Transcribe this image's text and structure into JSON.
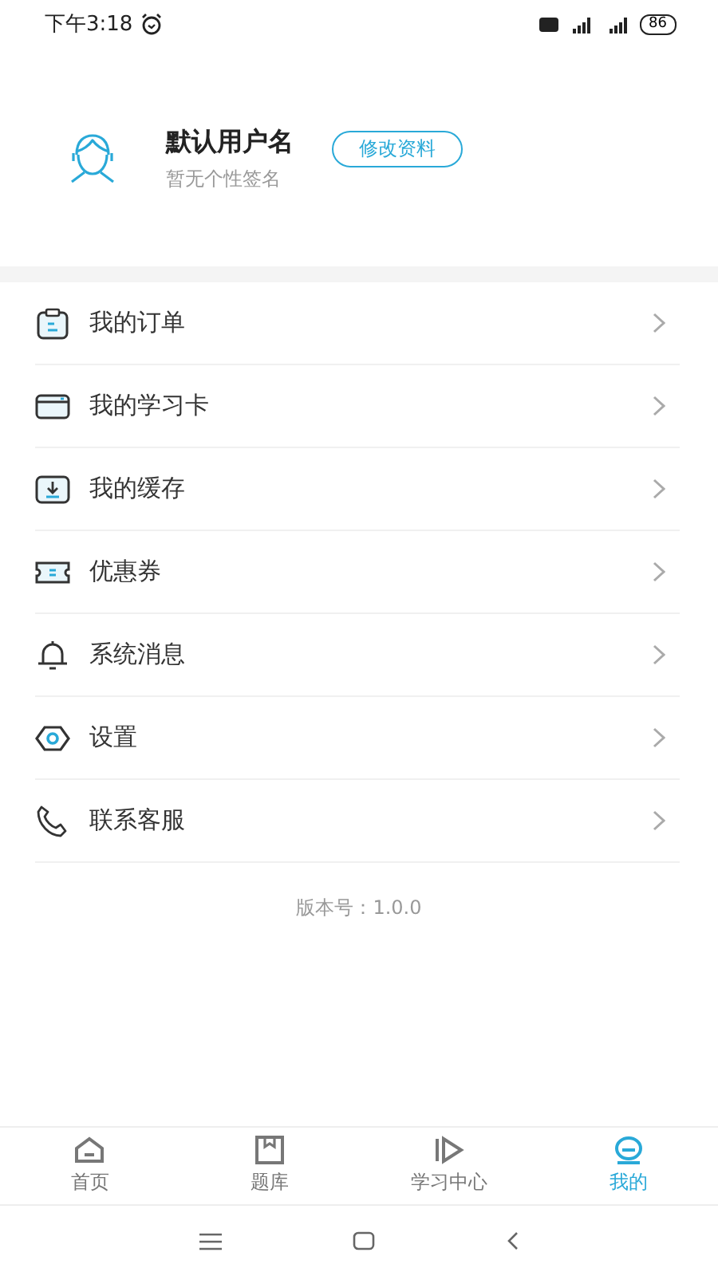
{
  "status_bar": {
    "time": "下午3:18",
    "battery": "86"
  },
  "profile": {
    "name": "默认用户名",
    "signature": "暂无个性签名",
    "edit_button": "修改资料"
  },
  "menu": [
    {
      "label": "我的订单",
      "kind": "order"
    },
    {
      "label": "我的学习卡",
      "kind": "card"
    },
    {
      "label": "我的缓存",
      "kind": "download"
    },
    {
      "label": "优惠券",
      "kind": "coupon"
    },
    {
      "label": "系统消息",
      "kind": "bell"
    },
    {
      "label": "设置",
      "kind": "settings"
    },
    {
      "label": "联系客服",
      "kind": "phone"
    }
  ],
  "version": "版本号：1.0.0",
  "tabs": [
    {
      "label": "首页",
      "kind": "home",
      "selected": false
    },
    {
      "label": "题库",
      "kind": "bank",
      "selected": false
    },
    {
      "label": "学习中心",
      "kind": "play",
      "selected": false
    },
    {
      "label": "我的",
      "kind": "me",
      "selected": true
    }
  ]
}
